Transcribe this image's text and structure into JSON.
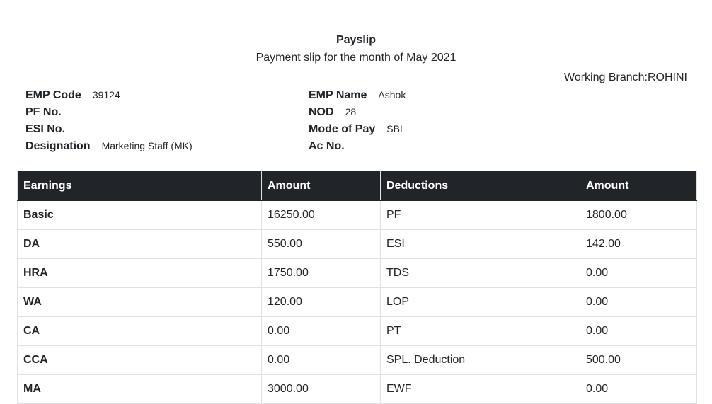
{
  "header": {
    "title": "Payslip",
    "subtitle": "Payment slip for the month of May 2021",
    "branch": "Working Branch:ROHINI"
  },
  "employee": {
    "emp_code_label": "EMP Code",
    "emp_code": "39124",
    "pf_no_label": "PF No.",
    "pf_no": "",
    "esi_no_label": "ESI No.",
    "esi_no": "",
    "designation_label": "Designation",
    "designation": "Marketing Staff (MK)",
    "emp_name_label": "EMP Name",
    "emp_name": "Ashok",
    "nod_label": "NOD",
    "nod": "28",
    "mode_of_pay_label": "Mode of Pay",
    "mode_of_pay": "SBI",
    "ac_no_label": "Ac No.",
    "ac_no": ""
  },
  "table": {
    "headers": [
      "Earnings",
      "Amount",
      "Deductions",
      "Amount"
    ],
    "rows": [
      {
        "earning": "Basic",
        "earning_amount": "16250.00",
        "deduction": "PF",
        "deduction_amount": "1800.00"
      },
      {
        "earning": "DA",
        "earning_amount": "550.00",
        "deduction": "ESI",
        "deduction_amount": "142.00"
      },
      {
        "earning": "HRA",
        "earning_amount": "1750.00",
        "deduction": "TDS",
        "deduction_amount": "0.00"
      },
      {
        "earning": "WA",
        "earning_amount": "120.00",
        "deduction": "LOP",
        "deduction_amount": "0.00"
      },
      {
        "earning": "CA",
        "earning_amount": "0.00",
        "deduction": "PT",
        "deduction_amount": "0.00"
      },
      {
        "earning": "CCA",
        "earning_amount": "0.00",
        "deduction": "SPL. Deduction",
        "deduction_amount": "500.00"
      },
      {
        "earning": "MA",
        "earning_amount": "3000.00",
        "deduction": "EWF",
        "deduction_amount": "0.00"
      }
    ]
  }
}
